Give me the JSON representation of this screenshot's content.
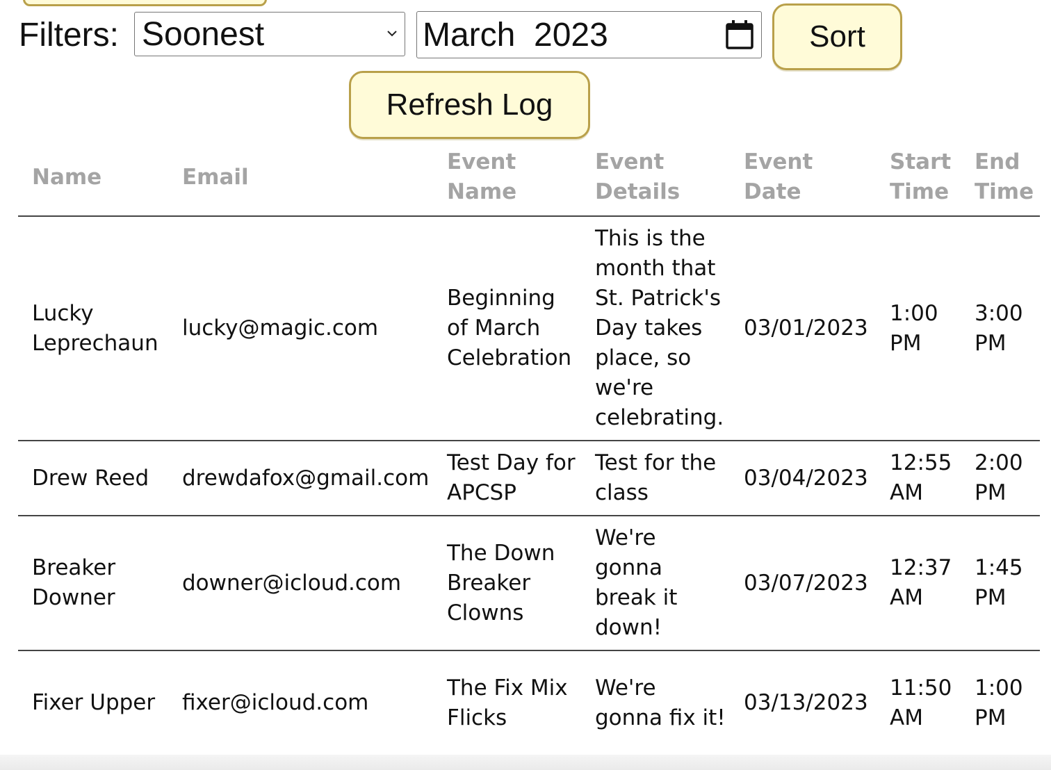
{
  "filters": {
    "label": "Filters:",
    "sort_select_value": "Soonest",
    "month_value": "March  2023",
    "sort_button": "Sort",
    "refresh_button": "Refresh Log"
  },
  "table": {
    "headers": [
      "Name",
      "Email",
      "Event Name",
      "Event Details",
      "Event Date",
      "Start Time",
      "End Time"
    ],
    "rows": [
      [
        "Lucky Leprechaun",
        "lucky@magic.com",
        "Beginning of March Celebration",
        "This is the month that St. Patrick's Day takes place, so we're celebrating.",
        "03/01/2023",
        "1:00 PM",
        "3:00 PM"
      ],
      [
        "Drew Reed",
        "drewdafox@gmail.com",
        "Test Day for APCSP",
        "Test for the class",
        "03/04/2023",
        "12:55 AM",
        "2:00 PM"
      ],
      [
        "Breaker Downer",
        "downer@icloud.com",
        "The Down Breaker Clowns",
        "We're gonna break it down!",
        "03/07/2023",
        "12:37 AM",
        "1:45 PM"
      ],
      [
        "Fixer Upper",
        "fixer@icloud.com",
        "The Fix Mix Flicks",
        "We're gonna fix it!",
        "03/13/2023",
        "11:50 AM",
        "1:00 PM"
      ]
    ]
  },
  "colors": {
    "button_bg": "#fffbd8",
    "button_border": "#b9a04a",
    "header_text": "#a4a4a4"
  },
  "icons": {
    "select": "chevron-down-icon",
    "date": "calendar-icon"
  }
}
